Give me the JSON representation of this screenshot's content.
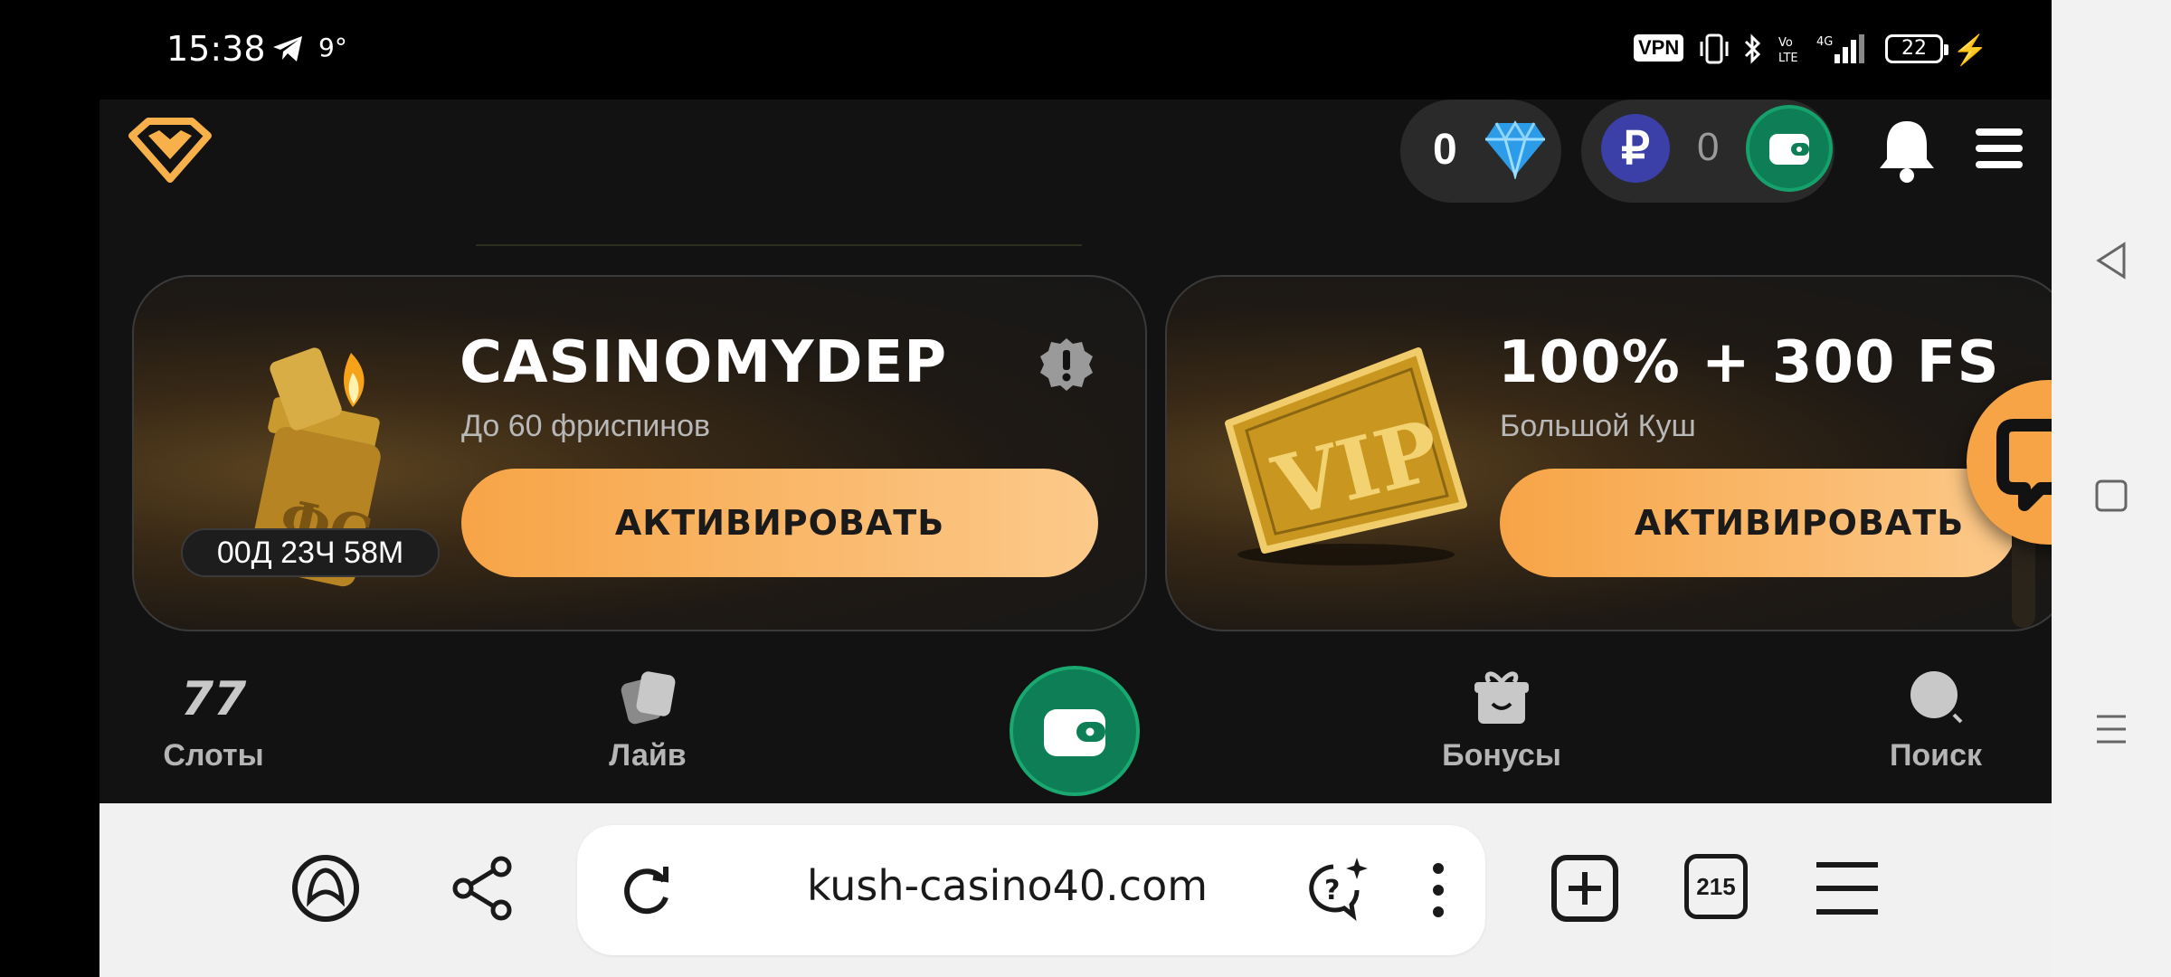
{
  "status_bar": {
    "time": "15:38",
    "temperature": "9°",
    "vpn": "VPN",
    "battery": "22"
  },
  "header": {
    "gems": "0",
    "balance": "0",
    "currency_symbol": "₽"
  },
  "promos": [
    {
      "title": "CASINOMYDEP",
      "subtitle": "До 60 фриспинов",
      "button": "АКТИВИРОВАТЬ",
      "timer": "00Д 23Ч 58М"
    },
    {
      "title": "100% + 300 FS",
      "subtitle": "Большой Куш",
      "button": "АКТИВИРОВАТЬ"
    }
  ],
  "site_nav": {
    "items": [
      {
        "label": "Слоты"
      },
      {
        "label": "Лайв"
      },
      {
        "label": "Бонусы"
      },
      {
        "label": "Поиск"
      }
    ]
  },
  "browser": {
    "url": "kush-casino40.com",
    "tabs_count": "215"
  },
  "colors": {
    "accent_orange": "#f7a446",
    "accent_green": "#0d7e55",
    "background": "#121212"
  }
}
